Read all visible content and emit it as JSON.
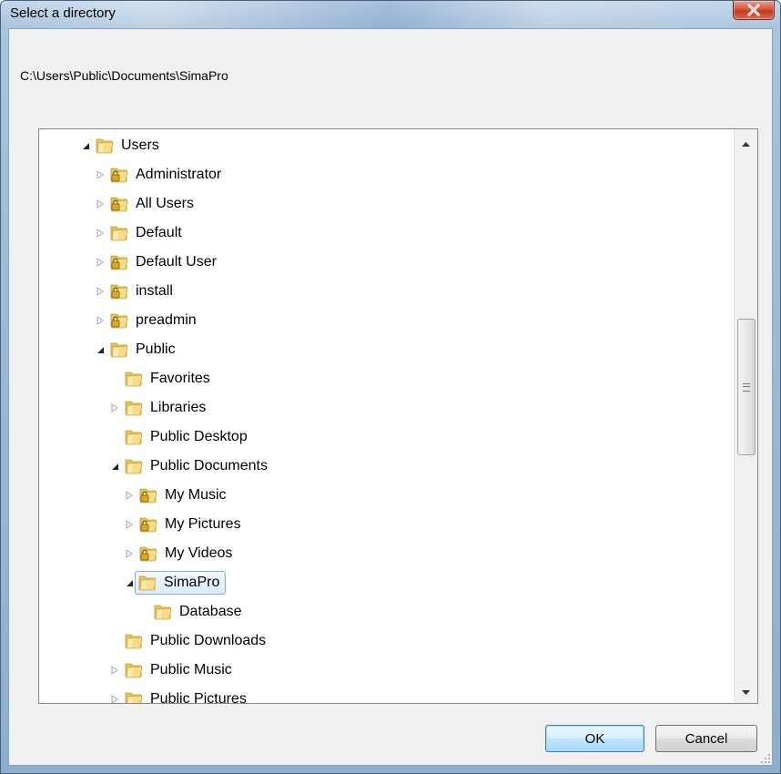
{
  "window": {
    "title": "Select a directory",
    "close_label": "Close"
  },
  "path": "C:\\Users\\Public\\Documents\\SimaPro",
  "tree": [
    {
      "label": "Users",
      "level": 0,
      "expander": "expanded",
      "locked": false,
      "selected": false
    },
    {
      "label": "Administrator",
      "level": 1,
      "expander": "collapsed",
      "locked": true,
      "selected": false
    },
    {
      "label": "All Users",
      "level": 1,
      "expander": "collapsed",
      "locked": true,
      "selected": false
    },
    {
      "label": "Default",
      "level": 1,
      "expander": "collapsed",
      "locked": false,
      "selected": false
    },
    {
      "label": "Default User",
      "level": 1,
      "expander": "collapsed",
      "locked": true,
      "selected": false
    },
    {
      "label": "install",
      "level": 1,
      "expander": "collapsed",
      "locked": true,
      "selected": false
    },
    {
      "label": "preadmin",
      "level": 1,
      "expander": "collapsed",
      "locked": true,
      "selected": false
    },
    {
      "label": "Public",
      "level": 1,
      "expander": "expanded",
      "locked": false,
      "selected": false
    },
    {
      "label": "Favorites",
      "level": 2,
      "expander": "none",
      "locked": false,
      "selected": false
    },
    {
      "label": "Libraries",
      "level": 2,
      "expander": "collapsed",
      "locked": false,
      "selected": false
    },
    {
      "label": "Public Desktop",
      "level": 2,
      "expander": "none",
      "locked": false,
      "selected": false
    },
    {
      "label": "Public Documents",
      "level": 2,
      "expander": "expanded",
      "locked": false,
      "selected": false
    },
    {
      "label": "My Music",
      "level": 3,
      "expander": "collapsed",
      "locked": true,
      "selected": false
    },
    {
      "label": "My Pictures",
      "level": 3,
      "expander": "collapsed",
      "locked": true,
      "selected": false
    },
    {
      "label": "My Videos",
      "level": 3,
      "expander": "collapsed",
      "locked": true,
      "selected": false
    },
    {
      "label": "SimaPro",
      "level": 3,
      "expander": "expanded",
      "locked": false,
      "selected": true
    },
    {
      "label": "Database",
      "level": 4,
      "expander": "none",
      "locked": false,
      "selected": false
    },
    {
      "label": "Public Downloads",
      "level": 2,
      "expander": "none",
      "locked": false,
      "selected": false
    },
    {
      "label": "Public Music",
      "level": 2,
      "expander": "collapsed",
      "locked": false,
      "selected": false
    },
    {
      "label": "Public Pictures",
      "level": 2,
      "expander": "collapsed",
      "locked": false,
      "selected": false
    }
  ],
  "buttons": {
    "ok": "OK",
    "cancel": "Cancel"
  },
  "colors": {
    "selection_border": "#84acdd",
    "folder": "#f4d27a"
  }
}
